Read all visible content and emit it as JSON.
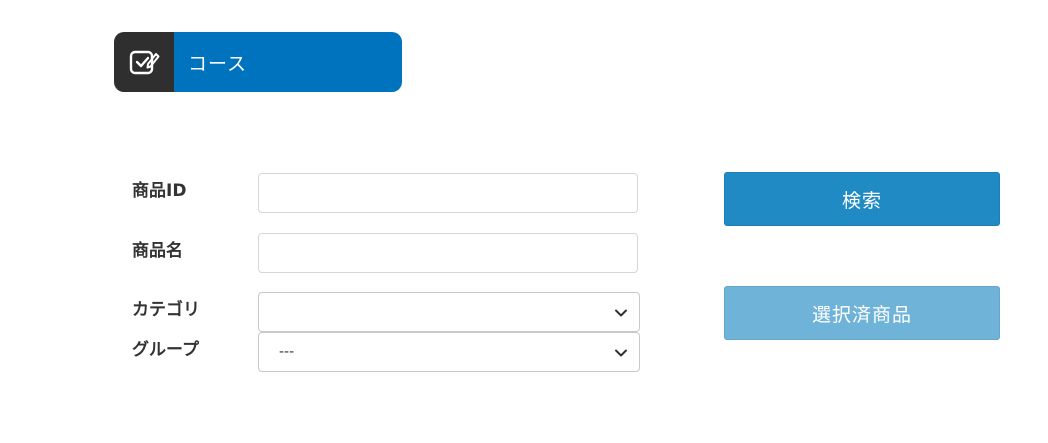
{
  "section": {
    "title": "コース",
    "icon": "checkbox-edit-icon"
  },
  "form": {
    "product_id": {
      "label": "商品ID",
      "value": "",
      "placeholder": ""
    },
    "product_name": {
      "label": "商品名",
      "value": "",
      "placeholder": ""
    },
    "category": {
      "label": "カテゴリ",
      "selected": ""
    },
    "group": {
      "label": "グループ",
      "selected": "---"
    }
  },
  "buttons": {
    "search": "検索",
    "selected_products": "選択済商品"
  },
  "colors": {
    "header_icon_bg": "#2f2f2f",
    "header_title_bg": "#0073be",
    "search_button": "#1f8ac4",
    "selected_button": "#6fb3d9"
  }
}
